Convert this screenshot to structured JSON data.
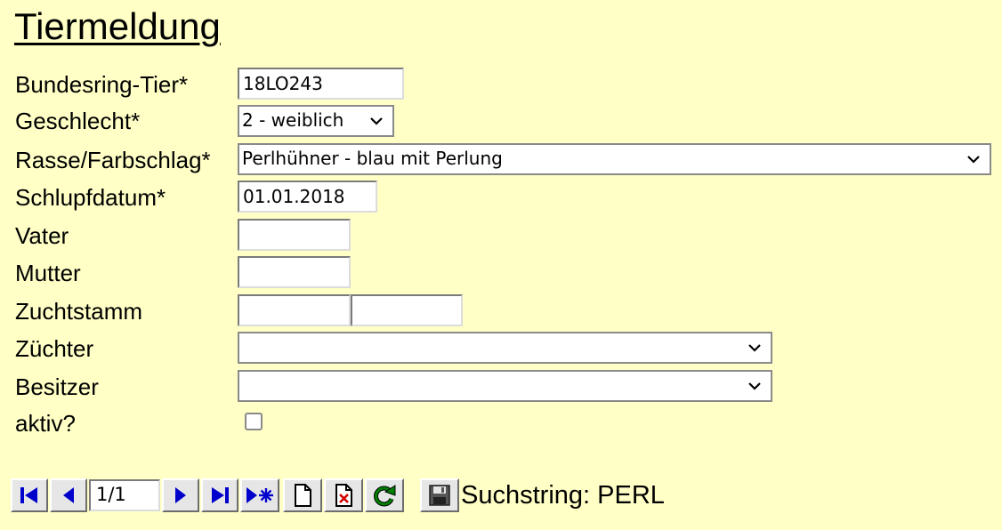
{
  "page": {
    "title": "Tiermeldung"
  },
  "form": {
    "ring": {
      "label": "Bundesring-Tier*",
      "value": "18LO243"
    },
    "sex": {
      "label": "Geschlecht*",
      "value": "2 - weiblich"
    },
    "breed": {
      "label": "Rasse/Farbschlag*",
      "value": "Perlhühner - blau mit Perlung"
    },
    "hatch": {
      "label": "Schlupfdatum*",
      "value": "01.01.2018"
    },
    "father": {
      "label": "Vater",
      "value": ""
    },
    "mother": {
      "label": "Mutter",
      "value": ""
    },
    "stock": {
      "label": "Zuchtstamm",
      "value1": "",
      "value2": ""
    },
    "breeder": {
      "label": "Züchter",
      "value": ""
    },
    "owner": {
      "label": "Besitzer",
      "value": ""
    },
    "active": {
      "label": "aktiv?",
      "checked": false
    }
  },
  "navigator": {
    "position": "1/1",
    "buttons": [
      "first-record-icon",
      "previous-record-icon",
      "next-record-icon",
      "last-record-icon",
      "new-record-icon",
      "new-document-icon",
      "delete-icon",
      "refresh-icon",
      "save-icon"
    ],
    "search_text": "Suchstring: PERL"
  },
  "colors": {
    "background": "#ffffc6",
    "nav_icon_blue": "#0000cc",
    "delete_red": "#d00000",
    "refresh_green": "#008000"
  }
}
